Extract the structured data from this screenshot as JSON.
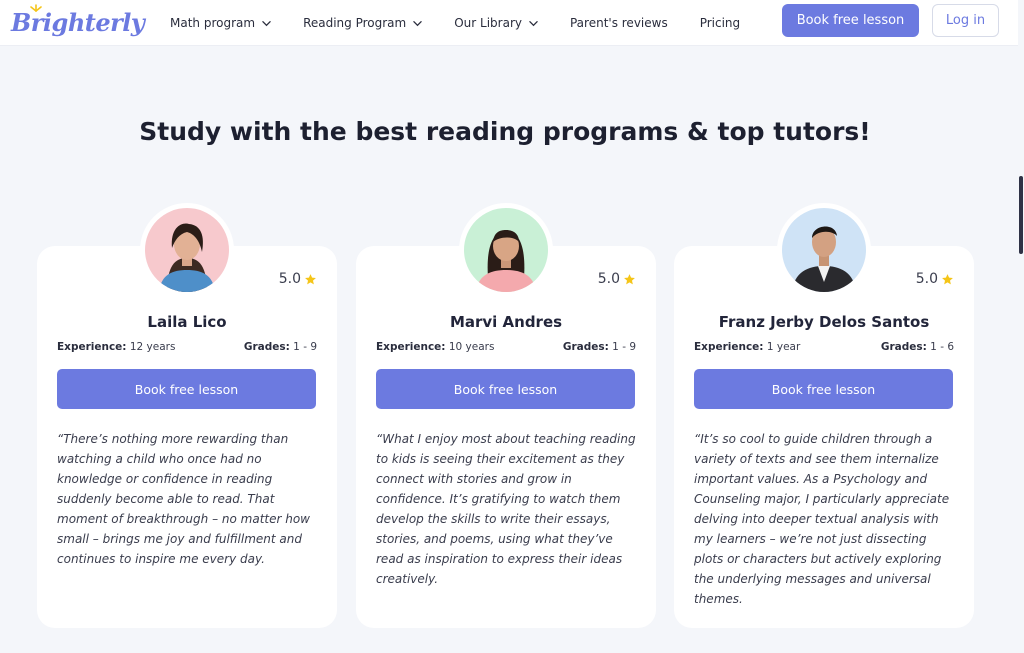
{
  "header": {
    "logo_text": "Brighterly",
    "nav": [
      {
        "label": "Math program",
        "has_dropdown": true
      },
      {
        "label": "Reading Program",
        "has_dropdown": true
      },
      {
        "label": "Our Library",
        "has_dropdown": true
      },
      {
        "label": "Parent's reviews",
        "has_dropdown": false
      },
      {
        "label": "Pricing",
        "has_dropdown": false
      }
    ],
    "book_label": "Book free lesson",
    "login_label": "Log in"
  },
  "section": {
    "title": "Study with the best reading programs & top tutors!"
  },
  "tutors": [
    {
      "name": "Laila Lico",
      "rating": "5.0",
      "experience_label": "Experience:",
      "experience": "12 years",
      "grades_label": "Grades:",
      "grades": "1 - 9",
      "button_label": "Book free lesson",
      "quote": "“There’s nothing more rewarding than watching a child who once had no knowledge or confidence in reading suddenly become able to read. That moment of breakthrough – no matter how small – brings me joy and fulfillment and continues to inspire me every day."
    },
    {
      "name": "Marvi Andres",
      "rating": "5.0",
      "experience_label": "Experience:",
      "experience": "10 years",
      "grades_label": "Grades:",
      "grades": "1 - 9",
      "button_label": "Book free lesson",
      "quote": "“What I enjoy most about teaching reading to kids is seeing their excitement as they connect with stories and grow in confidence. It’s gratifying to watch them develop the skills to write their essays, stories, and poems, using what they’ve read as inspiration to express their ideas creatively."
    },
    {
      "name": "Franz Jerby Delos Santos",
      "rating": "5.0",
      "experience_label": "Experience:",
      "experience": "1 year",
      "grades_label": "Grades:",
      "grades": "1 - 6",
      "button_label": "Book free lesson",
      "quote": "“It’s so cool to guide children through a variety of texts and see them internalize important values. As a Psychology and Counseling major, I particularly appreciate delving into deeper textual analysis with my learners – we’re not just dissecting plots or characters but actively exploring the underlying messages and universal themes."
    }
  ],
  "colors": {
    "accent": "#6c7ae0",
    "star": "#f5c518",
    "page_bg": "#f4f6fa"
  }
}
